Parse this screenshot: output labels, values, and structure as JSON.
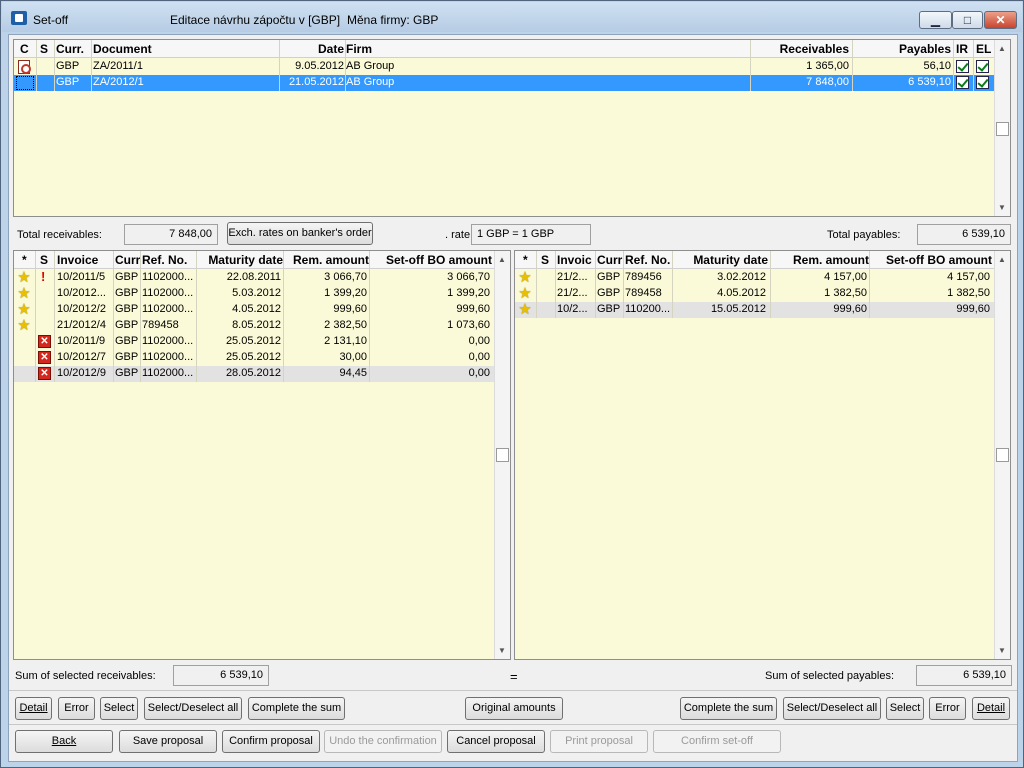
{
  "window": {
    "title": "Set-off",
    "subtitle": "Editace návrhu zápočtu v [GBP]",
    "currency_label": "Měna firmy: GBP"
  },
  "top_table": {
    "headers": [
      "C",
      "S",
      "Curr.",
      "Document",
      "Date",
      "Firm",
      "Receivables",
      "Payables",
      "IR",
      "EL"
    ],
    "rows": [
      {
        "curr": "GBP",
        "doc": "ZA/2011/1",
        "date": "9.05.2012",
        "firm": "AB Group",
        "rec": "1 365,00",
        "pay": "56,10"
      },
      {
        "curr": "GBP",
        "doc": "ZA/2012/1",
        "date": "21.05.2012",
        "firm": "AB Group",
        "rec": "7 848,00",
        "pay": "6 539,10"
      }
    ]
  },
  "totals": {
    "receivables_label": "Total receivables:",
    "receivables_value": "7 848,00",
    "exch_button": "Exch. rates on banker's order",
    "rate_label": ". rate",
    "rate_value": "1 GBP = 1 GBP",
    "payables_label": "Total payables:",
    "payables_value": "6 539,10"
  },
  "left_table": {
    "headers": [
      "*",
      "S",
      "Invoice",
      "Curr",
      "Ref. No.",
      "Maturity date",
      "Rem. amount",
      "Set-off BO amount"
    ],
    "rows": [
      {
        "inv": "10/2011/5",
        "curr": "GBP",
        "ref": "1102000...",
        "mat": "22.08.2011",
        "rem": "3 066,70",
        "set": "3 066,70"
      },
      {
        "inv": "10/2012...",
        "curr": "GBP",
        "ref": "1102000...",
        "mat": "5.03.2012",
        "rem": "1 399,20",
        "set": "1 399,20"
      },
      {
        "inv": "10/2012/2",
        "curr": "GBP",
        "ref": "1102000...",
        "mat": "4.05.2012",
        "rem": "999,60",
        "set": "999,60"
      },
      {
        "inv": "21/2012/4",
        "curr": "GBP",
        "ref": "789458",
        "mat": "8.05.2012",
        "rem": "2 382,50",
        "set": "1 073,60"
      },
      {
        "inv": "10/2011/9",
        "curr": "GBP",
        "ref": "1102000...",
        "mat": "25.05.2012",
        "rem": "2 131,10",
        "set": "0,00"
      },
      {
        "inv": "10/2012/7",
        "curr": "GBP",
        "ref": "1102000...",
        "mat": "25.05.2012",
        "rem": "30,00",
        "set": "0,00"
      },
      {
        "inv": "10/2012/9",
        "curr": "GBP",
        "ref": "1102000...",
        "mat": "28.05.2012",
        "rem": "94,45",
        "set": "0,00"
      }
    ]
  },
  "right_table": {
    "headers": [
      "*",
      "S",
      "Invoic",
      "Curr",
      "Ref. No.",
      "Maturity date",
      "Rem. amount",
      "Set-off BO amount"
    ],
    "rows": [
      {
        "inv": "21/2...",
        "curr": "GBP",
        "ref": "789456",
        "mat": "3.02.2012",
        "rem": "4 157,00",
        "set": "4 157,00"
      },
      {
        "inv": "21/2...",
        "curr": "GBP",
        "ref": "789458",
        "mat": "4.05.2012",
        "rem": "1 382,50",
        "set": "1 382,50"
      },
      {
        "inv": "10/2...",
        "curr": "GBP",
        "ref": "110200...",
        "mat": "15.05.2012",
        "rem": "999,60",
        "set": "999,60"
      }
    ]
  },
  "sums": {
    "rec_label": "Sum of selected receivables:",
    "rec_value": "6 539,10",
    "eq": "=",
    "pay_label": "Sum of selected payables:",
    "pay_value": "6 539,10"
  },
  "buttons": {
    "detail": "Detail",
    "error": "Error",
    "select": "Select",
    "select_all": "Select/Deselect all",
    "complete": "Complete the sum",
    "original": "Original amounts",
    "back": "Back",
    "save": "Save proposal",
    "confirm": "Confirm proposal",
    "undo": "Undo the confirmation",
    "cancel": "Cancel proposal",
    "print": "Print proposal",
    "confirm_setoff": "Confirm set-off"
  },
  "colors": {
    "grid_bg": "#fbfad8",
    "selection": "#3399ff"
  }
}
